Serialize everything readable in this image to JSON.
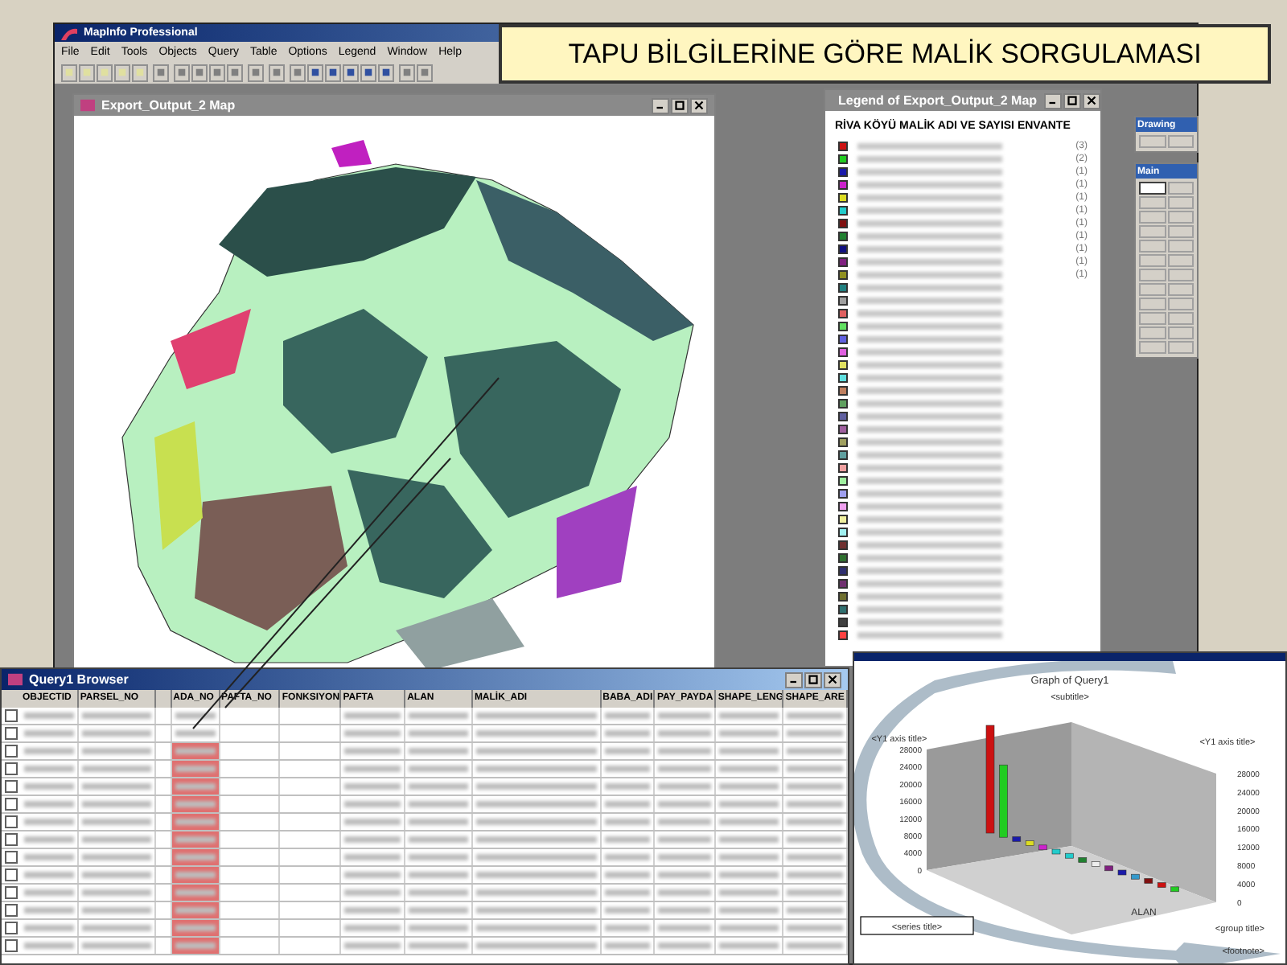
{
  "banner": {
    "title": "TAPU BİLGİLERİNE GÖRE MALİK SORGULAMASI"
  },
  "app": {
    "title": "MapInfo Professional",
    "menu": [
      "File",
      "Edit",
      "Tools",
      "Objects",
      "Query",
      "Table",
      "Options",
      "Legend",
      "Window",
      "Help"
    ]
  },
  "map_window": {
    "title": "Export_Output_2 Map"
  },
  "legend_window": {
    "title": "Legend of Export_Output_2 Map",
    "heading": "RİVA KÖYÜ MALİK ADI VE SAYISI ENVANTE",
    "items": [
      {
        "color": "#cc1111",
        "count": "(3)"
      },
      {
        "color": "#22cc22",
        "count": "(2)"
      },
      {
        "color": "#1a1aaa",
        "count": "(1)"
      },
      {
        "color": "#cc22cc",
        "count": "(1)"
      },
      {
        "color": "#dddd22",
        "count": "(1)"
      },
      {
        "color": "#22cccc",
        "count": "(1)"
      },
      {
        "color": "#801010",
        "count": "(1)"
      },
      {
        "color": "#208030",
        "count": "(1)"
      },
      {
        "color": "#101080",
        "count": "(1)"
      },
      {
        "color": "#802080",
        "count": "(1)"
      },
      {
        "color": "#909020",
        "count": "(1)"
      },
      {
        "color": "#208080"
      },
      {
        "color": "#a0a0a0"
      },
      {
        "color": "#e06060"
      },
      {
        "color": "#60e060"
      },
      {
        "color": "#6060e0"
      },
      {
        "color": "#e060e0"
      },
      {
        "color": "#e0e060"
      },
      {
        "color": "#60e0e0"
      },
      {
        "color": "#c08060"
      },
      {
        "color": "#60a060"
      },
      {
        "color": "#6060a0"
      },
      {
        "color": "#a060a0"
      },
      {
        "color": "#a0a060"
      },
      {
        "color": "#60a0a0"
      },
      {
        "color": "#f0a0a0"
      },
      {
        "color": "#a0f0a0"
      },
      {
        "color": "#a0a0f0"
      },
      {
        "color": "#f0a0f0"
      },
      {
        "color": "#f0f0a0"
      },
      {
        "color": "#a0f0f0"
      },
      {
        "color": "#703030"
      },
      {
        "color": "#307030"
      },
      {
        "color": "#303070"
      },
      {
        "color": "#703070"
      },
      {
        "color": "#707030"
      },
      {
        "color": "#307070"
      },
      {
        "color": "#404040"
      },
      {
        "color": "#ff4040"
      }
    ]
  },
  "drawing_toolbar": {
    "title": "Drawing",
    "tools": [
      {
        "selected": false
      },
      {
        "selected": false
      }
    ]
  },
  "main_toolbar": {
    "title": "Main",
    "tools": [
      {
        "selected": true
      },
      {
        "selected": false
      },
      {
        "selected": false
      },
      {
        "selected": false
      },
      {
        "selected": false
      },
      {
        "selected": false
      },
      {
        "selected": false
      },
      {
        "selected": false
      },
      {
        "selected": false
      },
      {
        "selected": false
      },
      {
        "selected": false
      },
      {
        "selected": false
      },
      {
        "selected": false
      },
      {
        "selected": false
      },
      {
        "selected": false
      },
      {
        "selected": false
      },
      {
        "selected": false
      },
      {
        "selected": false
      },
      {
        "selected": false
      },
      {
        "selected": false
      },
      {
        "selected": false
      },
      {
        "selected": false
      },
      {
        "selected": false
      },
      {
        "selected": false
      }
    ]
  },
  "browser": {
    "title": "Query1 Browser",
    "columns": [
      "OBJECTID",
      "PARSEL_NO",
      "",
      "ADA_NO",
      "PAFTA_NO",
      "FONKSIYON",
      "PAFTA",
      "ALAN",
      "MALİK_ADI",
      "BABA_ADI",
      "PAY_PAYDA",
      "SHAPE_LENG",
      "SHAPE_ARE"
    ],
    "rows": [
      {
        "checked": false
      },
      {
        "checked": false
      },
      {
        "checked": false
      },
      {
        "checked": false
      },
      {
        "checked": false
      },
      {
        "checked": false
      },
      {
        "checked": false
      },
      {
        "checked": false
      },
      {
        "checked": false
      },
      {
        "checked": false
      },
      {
        "checked": false
      },
      {
        "checked": false
      },
      {
        "checked": false
      },
      {
        "checked": false
      }
    ]
  },
  "graph": {
    "title": "Graph of Query1",
    "subtitle": "<subtitle>",
    "y1_left": "<Y1 axis title>",
    "y1_right": "<Y1 axis title>",
    "axis_label": "ALAN",
    "series_title": "<series title>",
    "group_title": "<group title>",
    "footnote": "<footnote>",
    "left_ticks": [
      "28000",
      "24000",
      "20000",
      "16000",
      "12000",
      "8000",
      "4000",
      "0"
    ],
    "right_ticks": [
      "28000",
      "24000",
      "20000",
      "16000",
      "12000",
      "8000",
      "4000",
      "0"
    ]
  }
}
